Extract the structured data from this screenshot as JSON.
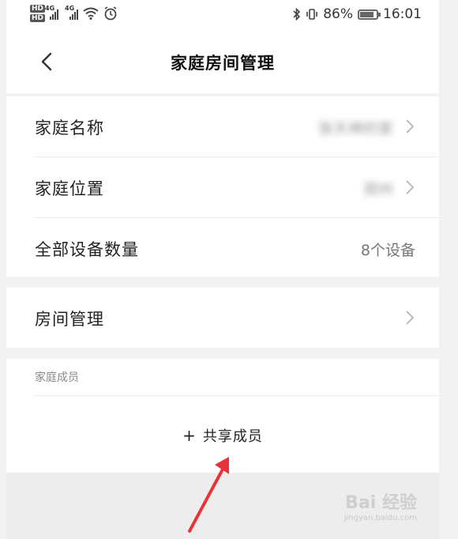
{
  "statusbar": {
    "network_badges": [
      "HD",
      "HD"
    ],
    "signal1_label": "4G",
    "signal2_label": "4G",
    "battery_text": "86%",
    "battery_level": 0.86,
    "time": "16:01"
  },
  "navbar": {
    "title": "家庭房间管理"
  },
  "rows": {
    "home_name": {
      "label": "家庭名称",
      "value": "张天神的家"
    },
    "home_location": {
      "label": "家庭位置",
      "value": "郑州"
    },
    "device_count": {
      "label": "全部设备数量",
      "value": "8个设备"
    },
    "room_manage": {
      "label": "房间管理"
    }
  },
  "members": {
    "section_label": "家庭成员",
    "share_button_plus": "+",
    "share_button_label": "共享成员"
  },
  "watermark": {
    "brand": "Bai 经验",
    "url": "jingyan.baidu.com"
  },
  "colors": {
    "arrow": "#e8333a",
    "background": "#ffffff",
    "section_gap": "#f3f3f3"
  }
}
